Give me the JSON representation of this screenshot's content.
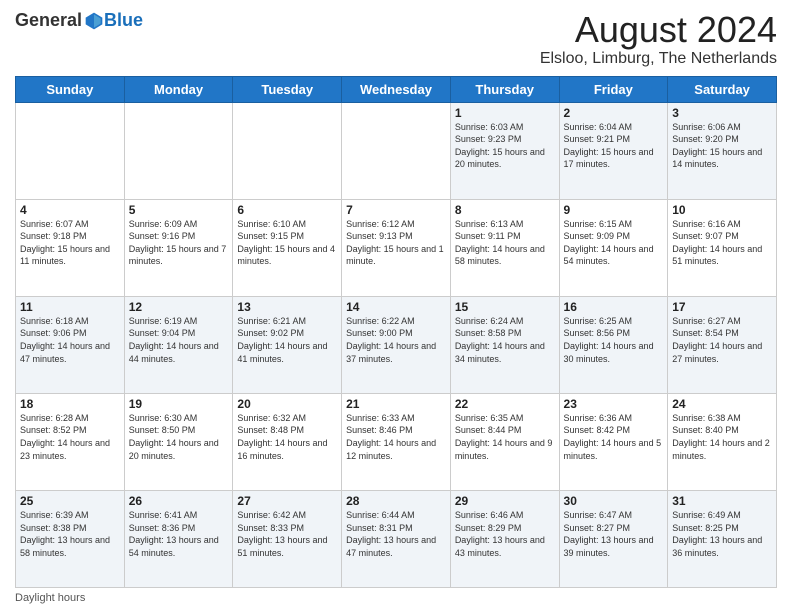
{
  "header": {
    "logo_general": "General",
    "logo_blue": "Blue",
    "main_title": "August 2024",
    "subtitle": "Elsloo, Limburg, The Netherlands"
  },
  "calendar": {
    "days_of_week": [
      "Sunday",
      "Monday",
      "Tuesday",
      "Wednesday",
      "Thursday",
      "Friday",
      "Saturday"
    ],
    "weeks": [
      [
        {
          "day": "",
          "sunrise": "",
          "sunset": "",
          "daylight": ""
        },
        {
          "day": "",
          "sunrise": "",
          "sunset": "",
          "daylight": ""
        },
        {
          "day": "",
          "sunrise": "",
          "sunset": "",
          "daylight": ""
        },
        {
          "day": "",
          "sunrise": "",
          "sunset": "",
          "daylight": ""
        },
        {
          "day": "1",
          "sunrise": "Sunrise: 6:03 AM",
          "sunset": "Sunset: 9:23 PM",
          "daylight": "Daylight: 15 hours and 20 minutes."
        },
        {
          "day": "2",
          "sunrise": "Sunrise: 6:04 AM",
          "sunset": "Sunset: 9:21 PM",
          "daylight": "Daylight: 15 hours and 17 minutes."
        },
        {
          "day": "3",
          "sunrise": "Sunrise: 6:06 AM",
          "sunset": "Sunset: 9:20 PM",
          "daylight": "Daylight: 15 hours and 14 minutes."
        }
      ],
      [
        {
          "day": "4",
          "sunrise": "Sunrise: 6:07 AM",
          "sunset": "Sunset: 9:18 PM",
          "daylight": "Daylight: 15 hours and 11 minutes."
        },
        {
          "day": "5",
          "sunrise": "Sunrise: 6:09 AM",
          "sunset": "Sunset: 9:16 PM",
          "daylight": "Daylight: 15 hours and 7 minutes."
        },
        {
          "day": "6",
          "sunrise": "Sunrise: 6:10 AM",
          "sunset": "Sunset: 9:15 PM",
          "daylight": "Daylight: 15 hours and 4 minutes."
        },
        {
          "day": "7",
          "sunrise": "Sunrise: 6:12 AM",
          "sunset": "Sunset: 9:13 PM",
          "daylight": "Daylight: 15 hours and 1 minute."
        },
        {
          "day": "8",
          "sunrise": "Sunrise: 6:13 AM",
          "sunset": "Sunset: 9:11 PM",
          "daylight": "Daylight: 14 hours and 58 minutes."
        },
        {
          "day": "9",
          "sunrise": "Sunrise: 6:15 AM",
          "sunset": "Sunset: 9:09 PM",
          "daylight": "Daylight: 14 hours and 54 minutes."
        },
        {
          "day": "10",
          "sunrise": "Sunrise: 6:16 AM",
          "sunset": "Sunset: 9:07 PM",
          "daylight": "Daylight: 14 hours and 51 minutes."
        }
      ],
      [
        {
          "day": "11",
          "sunrise": "Sunrise: 6:18 AM",
          "sunset": "Sunset: 9:06 PM",
          "daylight": "Daylight: 14 hours and 47 minutes."
        },
        {
          "day": "12",
          "sunrise": "Sunrise: 6:19 AM",
          "sunset": "Sunset: 9:04 PM",
          "daylight": "Daylight: 14 hours and 44 minutes."
        },
        {
          "day": "13",
          "sunrise": "Sunrise: 6:21 AM",
          "sunset": "Sunset: 9:02 PM",
          "daylight": "Daylight: 14 hours and 41 minutes."
        },
        {
          "day": "14",
          "sunrise": "Sunrise: 6:22 AM",
          "sunset": "Sunset: 9:00 PM",
          "daylight": "Daylight: 14 hours and 37 minutes."
        },
        {
          "day": "15",
          "sunrise": "Sunrise: 6:24 AM",
          "sunset": "Sunset: 8:58 PM",
          "daylight": "Daylight: 14 hours and 34 minutes."
        },
        {
          "day": "16",
          "sunrise": "Sunrise: 6:25 AM",
          "sunset": "Sunset: 8:56 PM",
          "daylight": "Daylight: 14 hours and 30 minutes."
        },
        {
          "day": "17",
          "sunrise": "Sunrise: 6:27 AM",
          "sunset": "Sunset: 8:54 PM",
          "daylight": "Daylight: 14 hours and 27 minutes."
        }
      ],
      [
        {
          "day": "18",
          "sunrise": "Sunrise: 6:28 AM",
          "sunset": "Sunset: 8:52 PM",
          "daylight": "Daylight: 14 hours and 23 minutes."
        },
        {
          "day": "19",
          "sunrise": "Sunrise: 6:30 AM",
          "sunset": "Sunset: 8:50 PM",
          "daylight": "Daylight: 14 hours and 20 minutes."
        },
        {
          "day": "20",
          "sunrise": "Sunrise: 6:32 AM",
          "sunset": "Sunset: 8:48 PM",
          "daylight": "Daylight: 14 hours and 16 minutes."
        },
        {
          "day": "21",
          "sunrise": "Sunrise: 6:33 AM",
          "sunset": "Sunset: 8:46 PM",
          "daylight": "Daylight: 14 hours and 12 minutes."
        },
        {
          "day": "22",
          "sunrise": "Sunrise: 6:35 AM",
          "sunset": "Sunset: 8:44 PM",
          "daylight": "Daylight: 14 hours and 9 minutes."
        },
        {
          "day": "23",
          "sunrise": "Sunrise: 6:36 AM",
          "sunset": "Sunset: 8:42 PM",
          "daylight": "Daylight: 14 hours and 5 minutes."
        },
        {
          "day": "24",
          "sunrise": "Sunrise: 6:38 AM",
          "sunset": "Sunset: 8:40 PM",
          "daylight": "Daylight: 14 hours and 2 minutes."
        }
      ],
      [
        {
          "day": "25",
          "sunrise": "Sunrise: 6:39 AM",
          "sunset": "Sunset: 8:38 PM",
          "daylight": "Daylight: 13 hours and 58 minutes."
        },
        {
          "day": "26",
          "sunrise": "Sunrise: 6:41 AM",
          "sunset": "Sunset: 8:36 PM",
          "daylight": "Daylight: 13 hours and 54 minutes."
        },
        {
          "day": "27",
          "sunrise": "Sunrise: 6:42 AM",
          "sunset": "Sunset: 8:33 PM",
          "daylight": "Daylight: 13 hours and 51 minutes."
        },
        {
          "day": "28",
          "sunrise": "Sunrise: 6:44 AM",
          "sunset": "Sunset: 8:31 PM",
          "daylight": "Daylight: 13 hours and 47 minutes."
        },
        {
          "day": "29",
          "sunrise": "Sunrise: 6:46 AM",
          "sunset": "Sunset: 8:29 PM",
          "daylight": "Daylight: 13 hours and 43 minutes."
        },
        {
          "day": "30",
          "sunrise": "Sunrise: 6:47 AM",
          "sunset": "Sunset: 8:27 PM",
          "daylight": "Daylight: 13 hours and 39 minutes."
        },
        {
          "day": "31",
          "sunrise": "Sunrise: 6:49 AM",
          "sunset": "Sunset: 8:25 PM",
          "daylight": "Daylight: 13 hours and 36 minutes."
        }
      ]
    ]
  },
  "footer": {
    "label": "Daylight hours"
  }
}
